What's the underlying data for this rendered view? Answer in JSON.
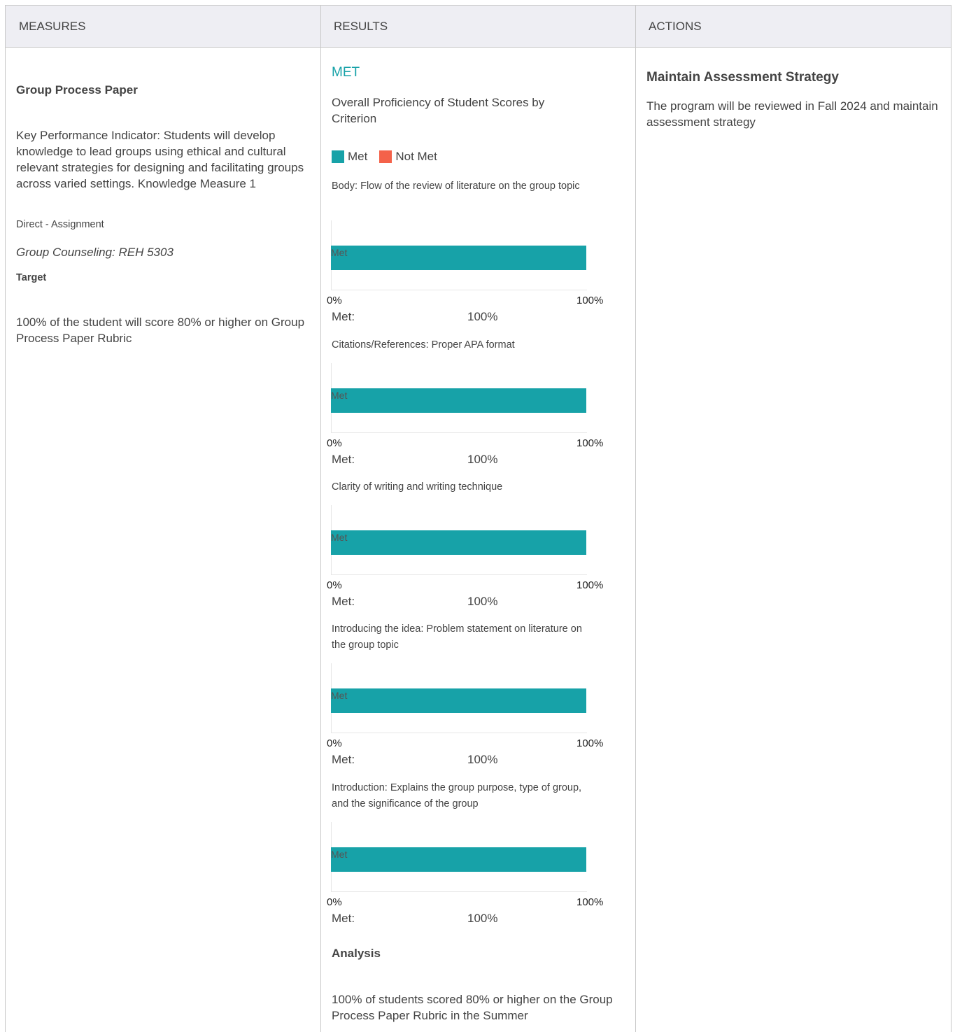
{
  "headers": {
    "measures": "MEASURES",
    "results": "RESULTS",
    "actions": "ACTIONS"
  },
  "measures": {
    "title": "Group Process Paper",
    "kpi": "Key Performance Indicator: Students will develop knowledge to lead groups using ethical and cultural relevant strategies for designing and facilitating groups across varied settings. Knowledge Measure 1",
    "type": "Direct - Assignment",
    "course": "Group Counseling: REH 5303",
    "target_label": "Target",
    "target_text": "100% of the student will score 80% or higher on Group Process Paper Rubric"
  },
  "results": {
    "status": "MET",
    "heading": "Overall Proficiency of Student Scores by Criterion",
    "legend": {
      "met": "Met",
      "not_met": "Not Met"
    },
    "met_label": "Met:",
    "bar_label": "Met",
    "analysis_label": "Analysis",
    "analysis_text": "100% of students scored 80% or higher on the Group Process Paper Rubric in the Summer"
  },
  "chart_data": {
    "type": "bar",
    "orientation": "horizontal",
    "colors": {
      "met": "#17a2a8",
      "not_met": "#f4624a"
    },
    "categories": [
      "Body: Flow of the review of literature on the group topic",
      "Citations/References: Proper APA format",
      "Clarity of writing and writing technique",
      "Introducing the idea: Problem statement on literature on the group topic",
      "Introduction: Explains the group purpose, type of group, and the significance of the group"
    ],
    "series": [
      {
        "name": "Met",
        "values": [
          100,
          100,
          100,
          100,
          100
        ]
      }
    ],
    "value_labels": [
      "100%",
      "100%",
      "100%",
      "100%",
      "100%"
    ],
    "xlim": [
      0,
      100
    ],
    "ticks": [
      "0%",
      "100%"
    ]
  },
  "actions": {
    "title": "Maintain Assessment Strategy",
    "text": "The program will be reviewed in Fall 2024 and maintain assessment strategy"
  }
}
